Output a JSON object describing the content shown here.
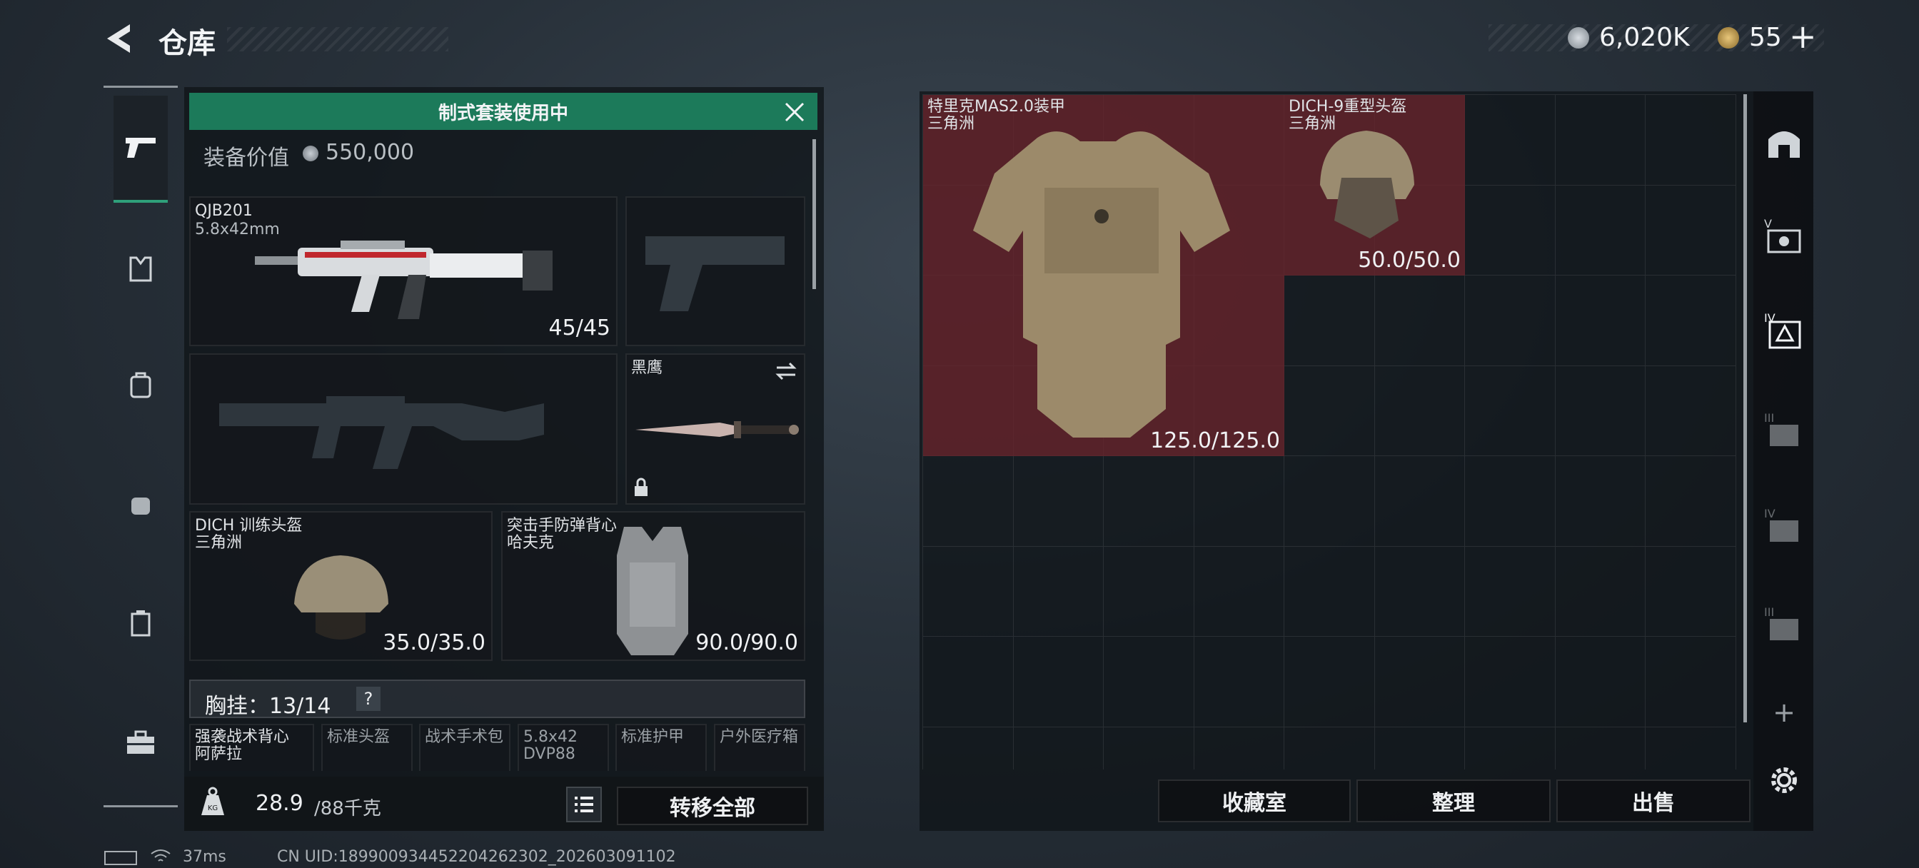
{
  "header": {
    "title": "仓库",
    "currency1": "6,020K",
    "currency2": "55",
    "add": "+"
  },
  "loadout": {
    "banner": "制式套装使用中",
    "value_label": "装备价值",
    "value": "550,000",
    "primary": {
      "name": "QJB201",
      "ammo": "5.8x42mm",
      "count": "45/45"
    },
    "knife": {
      "name": "黑鹰"
    },
    "helmet": {
      "name": "DICH 训练头盔",
      "origin": "三角洲",
      "durability": "35.0/35.0"
    },
    "armor": {
      "name": "突击手防弹背心",
      "origin": "哈夫克",
      "durability": "90.0/90.0"
    },
    "chest_rig": {
      "label": "胸挂：13/14",
      "help": "?"
    },
    "rig_items": [
      "强袭战术背心",
      "标准头盔",
      "战术手术包",
      "5.8x42",
      "标准护甲",
      "户外医疗箱"
    ],
    "rig_item1_sub": "阿萨拉",
    "rig_item4_sub": "DVP88",
    "weight": "28.9",
    "weight_max": "/88千克",
    "transfer_all": "转移全部"
  },
  "stash": {
    "armor_item": {
      "name": "特里克MAS2.0装甲",
      "origin": "三角洲",
      "durability": "125.0/125.0"
    },
    "helmet_item": {
      "name": "DICH-9重型头盔",
      "origin": "三角洲",
      "durability": "50.0/50.0"
    },
    "btn_collection": "收藏室",
    "btn_sort": "整理",
    "btn_sell": "出售",
    "add": "+"
  },
  "status": {
    "ping": "37ms",
    "uid": "CN UID:18990093445220426230​2_202603091102"
  },
  "colors": {
    "accent_green": "#1c7a5a",
    "red_cell": "#6a242c"
  }
}
